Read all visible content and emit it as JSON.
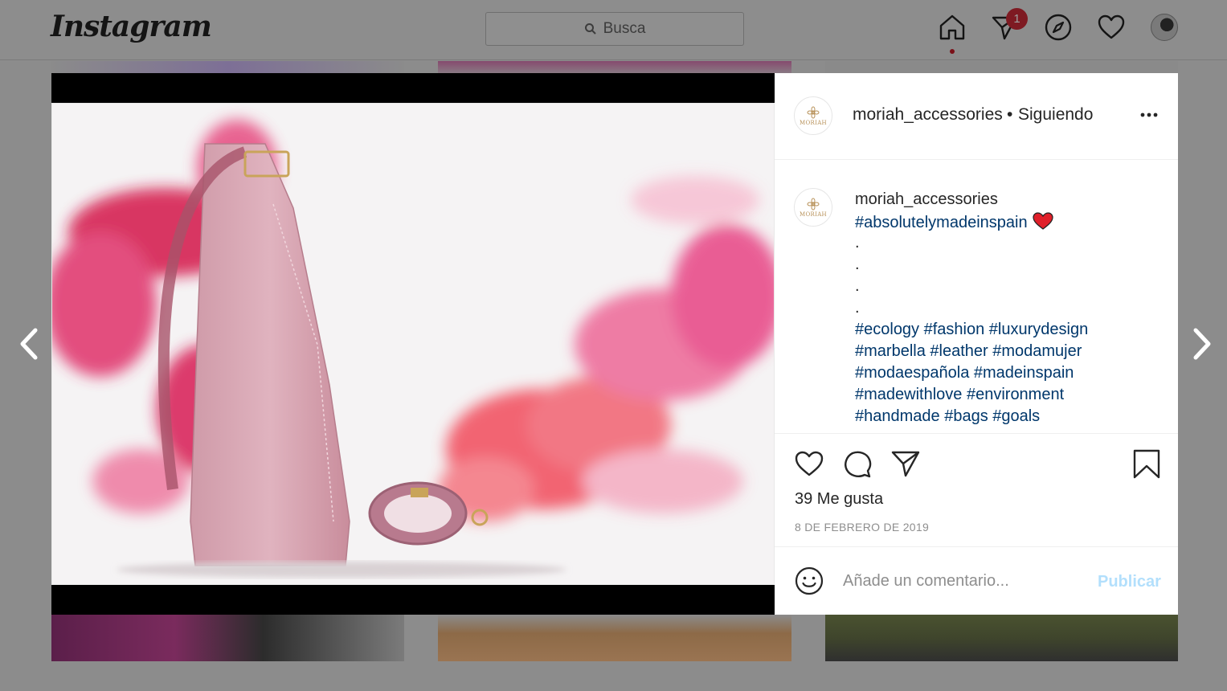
{
  "nav": {
    "logo": "Instagram",
    "search_placeholder": "Busca",
    "notification_count": "1",
    "icons": [
      "home-icon",
      "direct-icon",
      "explore-icon",
      "activity-heart-icon",
      "profile-avatar"
    ]
  },
  "post": {
    "username": "moriah_accessories",
    "separator": "•",
    "follow_status": "Siguiendo",
    "avatar_text": "MORIAH",
    "caption": {
      "username": "moriah_accessories",
      "hashtag_line": "#absolutelymadeinspain",
      "dots": [
        ".",
        ".",
        ".",
        "."
      ],
      "hashtag_lines": [
        "#ecology #fashion #luxurydesign",
        "#marbella #leather #modamujer",
        "#modaespañola #madeinspain",
        "#madewithlove #environment",
        "#handmade #bags #goals"
      ]
    },
    "likes": "39 Me gusta",
    "date": "8 DE FEBRERO DE 2019",
    "comment_placeholder": "Añade un comentario...",
    "publish_label": "Publicar"
  },
  "colors": {
    "link": "#00376b",
    "publish_disabled": "#b2dffc",
    "overlay": "#8c8c8c",
    "heart_emoji": "#e0202a"
  }
}
